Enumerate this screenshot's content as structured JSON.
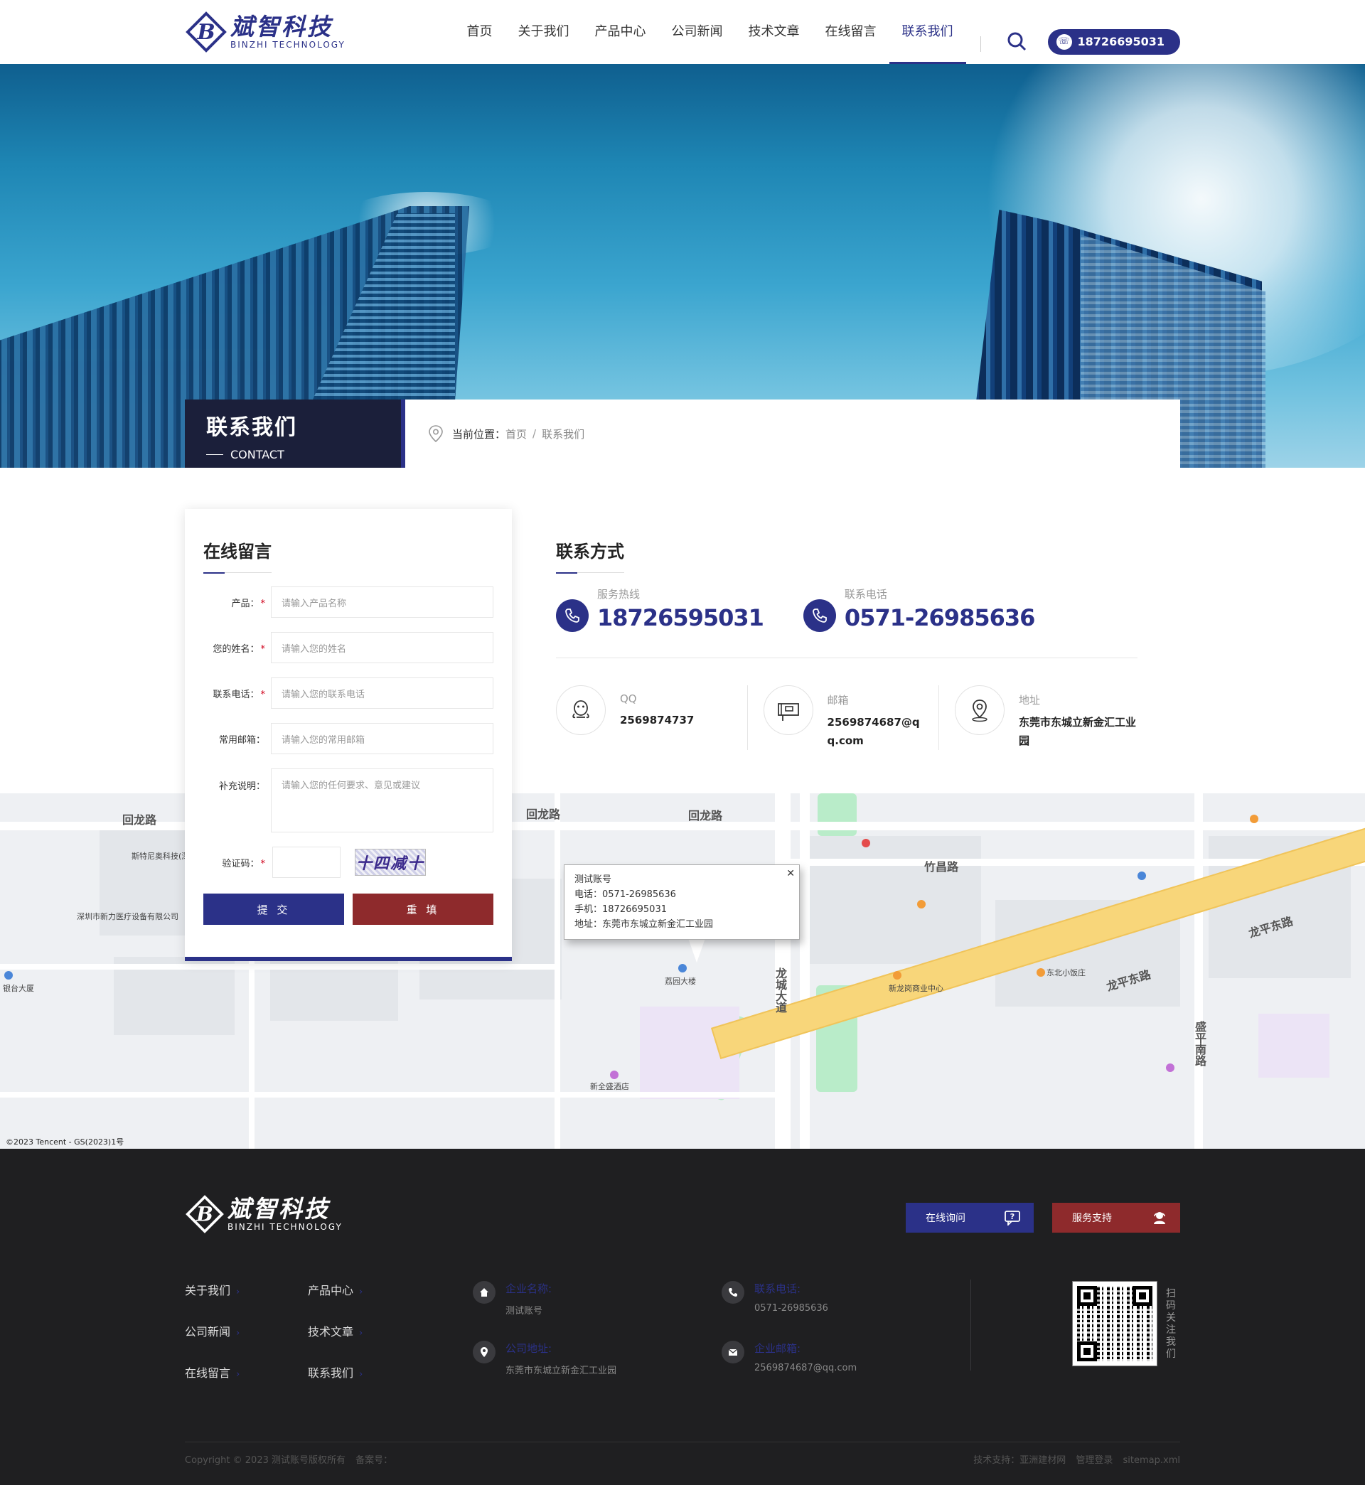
{
  "header": {
    "logo_cn": "斌智科技",
    "logo_en": "BINZHI TECHNOLOGY",
    "nav": [
      "首页",
      "关于我们",
      "产品中心",
      "公司新闻",
      "技术文章",
      "在线留言",
      "联系我们"
    ],
    "active_nav": "联系我们",
    "phone": "18726695031"
  },
  "banner": {
    "title_cn": "联系我们",
    "title_en": "CONTACT",
    "crumb_label": "当前位置：",
    "crumb_home": "首页",
    "crumb_sep": "/",
    "crumb_current": "联系我们"
  },
  "form": {
    "title": "在线留言",
    "fields": {
      "product": {
        "label": "产品：",
        "placeholder": "请输入产品名称"
      },
      "name": {
        "label": "您的姓名：",
        "placeholder": "请输入您的姓名"
      },
      "phone": {
        "label": "联系电话：",
        "placeholder": "请输入您的联系电话"
      },
      "email": {
        "label": "常用邮箱：",
        "placeholder": "请输入您的常用邮箱"
      },
      "note": {
        "label": "补充说明：",
        "placeholder": "请输入您的任何要求、意见或建议"
      },
      "captcha": {
        "label": "验证码："
      }
    },
    "captcha_text": "十四减十",
    "submit": "提 交",
    "reset": "重 填"
  },
  "contact": {
    "title": "联系方式",
    "hotline_label": "服务热线",
    "hotline": "18726595031",
    "tel_label": "联系电话",
    "tel": "0571-26985636",
    "qq_label": "QQ",
    "qq": "2569874737",
    "email_label": "邮箱",
    "email": "2569874687@qq.com",
    "address_label": "地址",
    "address": "东莞市东城立新金汇工业园"
  },
  "map": {
    "popup_title": "测试账号",
    "popup_tel": "电话：0571-26985636",
    "popup_mobile": "手机：18726695031",
    "popup_addr": "地址：东莞市东城立新金汇工业园",
    "copyright": "©2023 Tencent - GS(2023)1号",
    "labels": {
      "huilong1": "回龙路",
      "huilong2": "回龙路",
      "huilong3": "回龙路",
      "longcheng": "龙城大道",
      "longping": "龙平东路",
      "longping2": "龙平东路",
      "zhuchang": "竹昌路",
      "shengping": "盛平南路",
      "lhdl": "荔园大楼",
      "xjs": "新全盛酒店",
      "sth": "斯特尼奥科技(深圳)有限公司",
      "xhl": "深圳市新力医疗设备有限公司",
      "yhdl": "银台大厦",
      "dongbei": "东北小饭庄",
      "xlg": "新龙岗商业中心"
    }
  },
  "footer": {
    "logo_cn": "斌智科技",
    "logo_en": "BINZHI TECHNOLOGY",
    "btn_ask": "在线询问",
    "btn_support": "服务支持",
    "links": [
      "关于我们",
      "产品中心",
      "公司新闻",
      "技术文章",
      "在线留言",
      "联系我们"
    ],
    "company_label": "企业名称:",
    "company": "测试账号",
    "tel_label": "联系电话:",
    "tel": "0571-26985636",
    "addr_label": "公司地址:",
    "addr": "东莞市东城立新金汇工业园",
    "mail_label": "企业邮箱:",
    "mail": "2569874687@qq.com",
    "qr_label": "扫码关注我们",
    "copyright": "Copyright © 2023 测试账号版权所有",
    "icp": "备案号：",
    "tech": "技术支持：亚洲建材网",
    "admin": "管理登录",
    "sitemap": "sitemap.xml"
  },
  "colors": {
    "brand": "#2b3188",
    "accent_red": "#8e2a2c",
    "footer_bg": "#1f1f21"
  }
}
